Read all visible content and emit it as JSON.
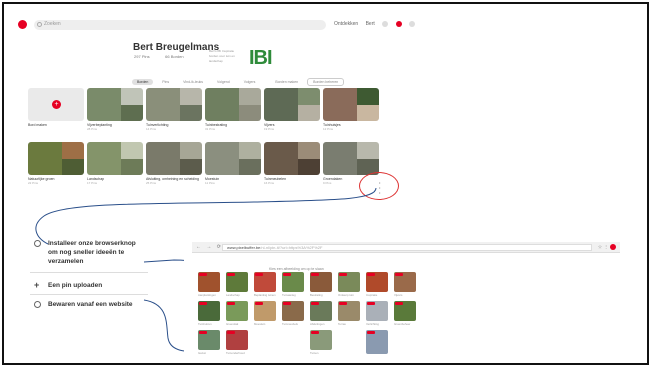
{
  "topbar": {
    "search_placeholder": "Zoeken",
    "links": [
      "Ontdekken",
      "Bert"
    ]
  },
  "profile": {
    "name": "Bert Breugelmans",
    "stats": [
      {
        "value": "297",
        "label": "Pins"
      },
      {
        "value": "66",
        "label": "Borden"
      }
    ],
    "description": "Bert's IBI Inspiratie borden voor tuin en landschap",
    "logo_text": "IBI"
  },
  "tabs": [
    "Borden",
    "Pins",
    "Vind-ik-leuks",
    "Volgend",
    "Volgers"
  ],
  "tabs_right": [
    "Borden maken",
    "Borden beheren"
  ],
  "boards_row1": [
    {
      "label": "Bord maken",
      "sub": "",
      "create": true
    },
    {
      "label": "Vijverbeplanting",
      "sub": "28 Pins",
      "colors": [
        "#7a8b6a",
        "#c0c4b8",
        "#5e6e50"
      ]
    },
    {
      "label": "Tuinverlichting",
      "sub": "14 Pins",
      "colors": [
        "#8a8f7a",
        "#b7b6aa",
        "#6b7460"
      ]
    },
    {
      "label": "Tuinbestrating",
      "sub": "31 Pins",
      "colors": [
        "#6f7f60",
        "#a9a99b",
        "#8c8c7c"
      ]
    },
    {
      "label": "Vijvers",
      "sub": "19 Pins",
      "colors": [
        "#5e6a55",
        "#7d8d6e",
        "#b5b0a2"
      ]
    },
    {
      "label": "Tuinhuisjes",
      "sub": "12 Pins",
      "colors": [
        "#8a6b5a",
        "#3e5a32",
        "#c9b7a0"
      ]
    }
  ],
  "boards_row2": [
    {
      "label": "Natuurlijke groen",
      "sub": "22 Pins",
      "colors": [
        "#6b7a3e",
        "#9e6f46",
        "#4e5d34"
      ]
    },
    {
      "label": "Landschap",
      "sub": "17 Pins",
      "colors": [
        "#84946a",
        "#c1c7b0",
        "#6d7b58"
      ]
    },
    {
      "label": "Afsluiting, omheining en scheiding",
      "sub": "25 Pins",
      "colors": [
        "#7a7a6a",
        "#a6a696",
        "#5c5c4c"
      ]
    },
    {
      "label": "Moestuin",
      "sub": "11 Pins",
      "colors": [
        "#8b8f7f",
        "#aeb09f",
        "#6a6f5d"
      ]
    },
    {
      "label": "Tuinmeubelen",
      "sub": "16 Pins",
      "colors": [
        "#6a5a4a",
        "#9b8c78",
        "#4d4034"
      ]
    },
    {
      "label": "Groendaken",
      "sub": "9 Pins",
      "colors": [
        "#7a7d70",
        "#b8b8ac",
        "#5f6354"
      ]
    }
  ],
  "side_dots": "•\n•\n•",
  "menu": [
    {
      "icon": "pinterest-circle-icon",
      "text": "Installeer onze browserknop\nom nog sneller ideeën te\nverzamelen"
    },
    {
      "icon": "plus-icon",
      "text": "Een pin uploaden"
    },
    {
      "icon": "globe-icon",
      "text": "Bewaren vanaf een website"
    }
  ],
  "browser": {
    "nav": [
      "←",
      "→",
      "⟳"
    ],
    "url_main": "www.pixelbuffer.be",
    "url_rest": "/nl-nl/pin-it/?url=https%3A%2F%2F",
    "heading": "Kies een afbeelding om op te slaan",
    "right": [
      "☆",
      "⋮"
    ]
  },
  "pins": [
    {
      "cap": "Aanplantingen",
      "color": "#a0522d"
    },
    {
      "cap": "Landschap",
      "color": "#5e7a3a"
    },
    {
      "cap": "Beplanting tuinen",
      "color": "#c04a3a"
    },
    {
      "cap": "Tuinaanleg",
      "color": "#6a8a4a"
    },
    {
      "cap": "Bestrating",
      "color": "#8a5a3a"
    },
    {
      "cap": "Ontwerp tuin",
      "color": "#7a8a5a"
    },
    {
      "cap": "Inspiratie",
      "color": "#b04a2a"
    },
    {
      "cap": "Vijvers",
      "color": "#9a6a4a"
    },
    {
      "cap": "Tuinhuizen",
      "color": "#4a6a3a"
    },
    {
      "cap": "Groendak",
      "color": "#7a9a5a"
    },
    {
      "cap": "Moestuin",
      "color": "#c09a6a"
    },
    {
      "cap": "Tuinmeubels",
      "color": "#8a6a4a"
    },
    {
      "cap": "Afsluitingen",
      "color": "#6a7a5a"
    },
    {
      "cap": "Terras",
      "color": "#9a8a6a"
    },
    {
      "cap": "Verlichting",
      "color": "#aab0b8"
    },
    {
      "cap": "Groenbeheer",
      "color": "#5a7a3a"
    },
    {
      "cap": "Gazon",
      "color": "#6a8a6a"
    },
    {
      "cap": "Tuinonderhoud",
      "color": "#b04040"
    },
    {
      "cap": "Tuinen",
      "color": "#8a9a7a"
    },
    {
      "cap": "",
      "color": "#8a9ab0"
    }
  ]
}
